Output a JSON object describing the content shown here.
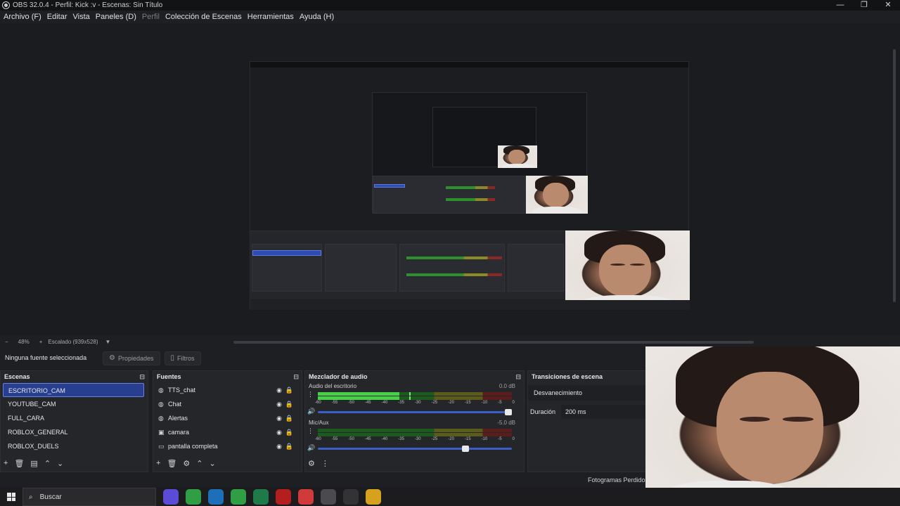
{
  "window": {
    "title": "OBS 32.0.4 - Perfil: Kick :v - Escenas: Sin Título",
    "controls": [
      "—",
      "❐",
      "✕"
    ]
  },
  "menu": {
    "items": [
      {
        "label": "Archivo (F)",
        "disabled": false
      },
      {
        "label": "Editar",
        "disabled": false
      },
      {
        "label": "Vista",
        "disabled": false
      },
      {
        "label": "Paneles (D)",
        "disabled": false
      },
      {
        "label": "Perfil",
        "disabled": true
      },
      {
        "label": "Colección de Escenas",
        "disabled": false
      },
      {
        "label": "Herramientas",
        "disabled": false
      },
      {
        "label": "Ayuda (H)",
        "disabled": false
      }
    ]
  },
  "preview": {
    "zoom_minus": "−",
    "zoom_value": "48%",
    "zoom_plus": "+",
    "scaling": "Escalado (939x528)",
    "dropdown": "▼"
  },
  "context": {
    "no_source": "Ninguna fuente seleccionada",
    "properties": "Propiedades",
    "filters": "Filtros"
  },
  "scenes": {
    "title": "Escenas",
    "items": [
      "ESCRITORIO_CAM",
      "YOUTUBE_CAM",
      "FULL_CARA",
      "ROBLOX_GENERAL",
      "ROBLOX_DUELS"
    ],
    "selected_index": 0
  },
  "sources": {
    "title": "Fuentes",
    "items": [
      {
        "name": "TTS_chat",
        "icon": "browser-icon"
      },
      {
        "name": "Chat",
        "icon": "browser-icon"
      },
      {
        "name": "Alertas",
        "icon": "browser-icon"
      },
      {
        "name": "camara",
        "icon": "camera-icon"
      },
      {
        "name": "pantalla completa",
        "icon": "monitor-icon"
      }
    ]
  },
  "mixer": {
    "title": "Mezclador de audio",
    "channels": [
      {
        "name": "Audio del escritorio",
        "db": "0.0 dB",
        "level": 0.42,
        "peak": 0.47,
        "volume": 1.0
      },
      {
        "name": "Mic/Aux",
        "db": "-5.0 dB",
        "level": 0.0,
        "peak": 0.0,
        "volume": 0.78
      }
    ],
    "ticks": [
      "-60",
      "-55",
      "-50",
      "-45",
      "-40",
      "-35",
      "-30",
      "-25",
      "-20",
      "-15",
      "-10",
      "-5",
      "0"
    ]
  },
  "transitions": {
    "title": "Transiciones de escena",
    "selected": "Desvanecimiento",
    "duration_label": "Duración",
    "duration_value": "200 ms"
  },
  "status": {
    "dropped_frames": "Fotogramas Perdidos"
  },
  "taskbar": {
    "search_placeholder": "Buscar",
    "apps": [
      {
        "name": "messenger-icon",
        "color": "#5b4bd6"
      },
      {
        "name": "chrome-icon",
        "color": "#2f9e44"
      },
      {
        "name": "vscode-like-icon",
        "color": "#1c6fb8"
      },
      {
        "name": "chrome-icon-2",
        "color": "#2f9e44"
      },
      {
        "name": "terminal-icon",
        "color": "#1f7a4a"
      },
      {
        "name": "voice-meeter-icon",
        "color": "#b31f1f"
      },
      {
        "name": "chrome-icon-3",
        "color": "#d13a3a"
      },
      {
        "name": "obs-capture-icon",
        "color": "#4a4a4f"
      },
      {
        "name": "obs-icon",
        "color": "#333336"
      },
      {
        "name": "folder-icon",
        "color": "#d6a21d"
      }
    ]
  },
  "colors": {
    "selection": "#283f8f",
    "accent": "#6583e6",
    "meter_green": "#46d246"
  }
}
